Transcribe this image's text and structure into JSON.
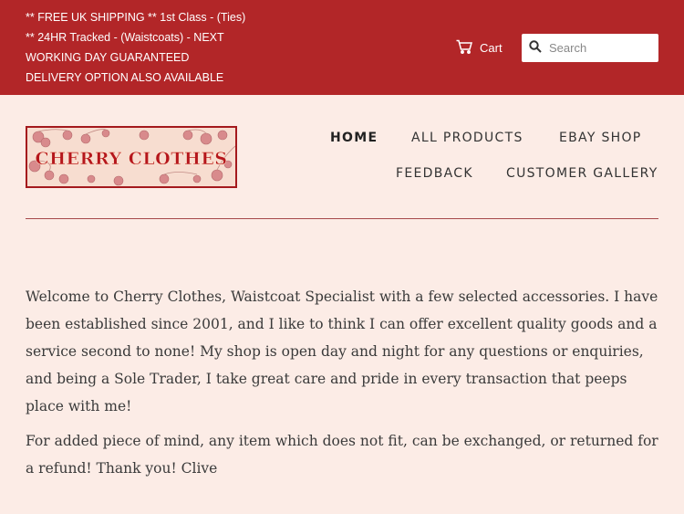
{
  "announcement": {
    "line1": "** FREE UK SHIPPING ** 1st Class - (Ties)",
    "line2": "** 24HR Tracked - (Waistcoats) - NEXT",
    "line3": "WORKING DAY GUARANTEED",
    "line4": "DELIVERY OPTION ALSO AVAILABLE"
  },
  "header": {
    "cart_label": "Cart",
    "search_placeholder": "Search",
    "cart_icon": "cart-icon",
    "search_icon": "search-icon"
  },
  "logo": {
    "text": "CHERRY CLOTHES"
  },
  "nav": {
    "items": [
      {
        "label": "HOME",
        "active": true
      },
      {
        "label": "ALL PRODUCTS",
        "active": false
      },
      {
        "label": "EBAY SHOP",
        "active": false
      },
      {
        "label": "FEEDBACK",
        "active": false
      },
      {
        "label": "CUSTOMER GALLERY",
        "active": false
      }
    ]
  },
  "main": {
    "paragraph1": "Welcome to Cherry Clothes, Waistcoat Specialist with a few selected accessories. I have been established since 2001, and I like to think I can offer excellent quality goods and a service second to none! My shop is open day and night for any questions or enquiries, and being a Sole Trader, I take great care and pride in every transaction that peeps place with me!",
    "paragraph2": "For added piece of mind, any item which does not fit, can be exchanged, or returned for a refund! Thank you! Clive"
  },
  "colors": {
    "topbar": "#b22628",
    "page_background": "#fcece6",
    "logo_text": "#b5161c"
  }
}
